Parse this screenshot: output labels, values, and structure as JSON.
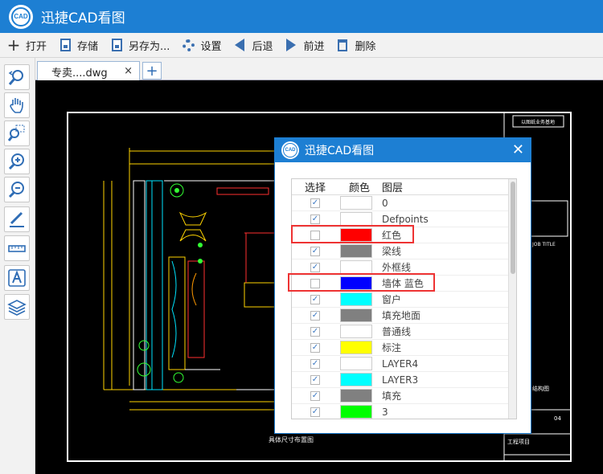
{
  "app": {
    "title": "迅捷CAD看图",
    "logo_text": "CAD"
  },
  "toolbar": {
    "buttons": [
      {
        "label": "打开",
        "icon": "plus-icon"
      },
      {
        "label": "存储",
        "icon": "save-icon"
      },
      {
        "label": "另存为...",
        "icon": "save-as-icon"
      },
      {
        "label": "设置",
        "icon": "gear-icon"
      },
      {
        "label": "后退",
        "icon": "arrow-left-icon"
      },
      {
        "label": "前进",
        "icon": "arrow-right-icon"
      },
      {
        "label": "删除",
        "icon": "trash-icon"
      }
    ]
  },
  "tools": [
    "rotate-zoom-icon",
    "pan-hand-icon",
    "zoom-window-icon",
    "zoom-in-icon",
    "zoom-out-icon",
    "pen-icon",
    "measure-icon",
    "text-icon",
    "layers-icon"
  ],
  "tab": {
    "label": "专卖....dwg",
    "close": "×",
    "add": "+"
  },
  "drawing": {
    "caption": "具体尺寸布置图",
    "job_title": "JOB TITLE",
    "sheet_no": "04",
    "block_title_1": "结构图",
    "block_title_2": "工程项目"
  },
  "dialog": {
    "title": "迅捷CAD看图",
    "close": "✕",
    "columns": {
      "select": "选择",
      "color": "颜色",
      "layer": "图层"
    },
    "layers": [
      {
        "name": "0",
        "checked": true,
        "color": "#ffffff"
      },
      {
        "name": "Defpoints",
        "checked": true,
        "color": "#ffffff"
      },
      {
        "name": "红色",
        "checked": false,
        "color": "#ff0000"
      },
      {
        "name": "梁线",
        "checked": true,
        "color": "#808080"
      },
      {
        "name": "外框线",
        "checked": true,
        "color": "#ffffff"
      },
      {
        "name": "墙体 蓝色",
        "checked": false,
        "color": "#0000ff"
      },
      {
        "name": "窗户",
        "checked": true,
        "color": "#00ffff"
      },
      {
        "name": "填充地面",
        "checked": true,
        "color": "#808080"
      },
      {
        "name": "普通线",
        "checked": true,
        "color": "#ffffff"
      },
      {
        "name": "标注",
        "checked": true,
        "color": "#ffff00"
      },
      {
        "name": "LAYER4",
        "checked": true,
        "color": "#ffffff"
      },
      {
        "name": "LAYER3",
        "checked": true,
        "color": "#00ffff"
      },
      {
        "name": "填充",
        "checked": true,
        "color": "#808080"
      },
      {
        "name": "3",
        "checked": true,
        "color": "#00ff00"
      }
    ]
  },
  "colors": {
    "accent": "#1d7fd3",
    "highlight": "#ee3333"
  }
}
